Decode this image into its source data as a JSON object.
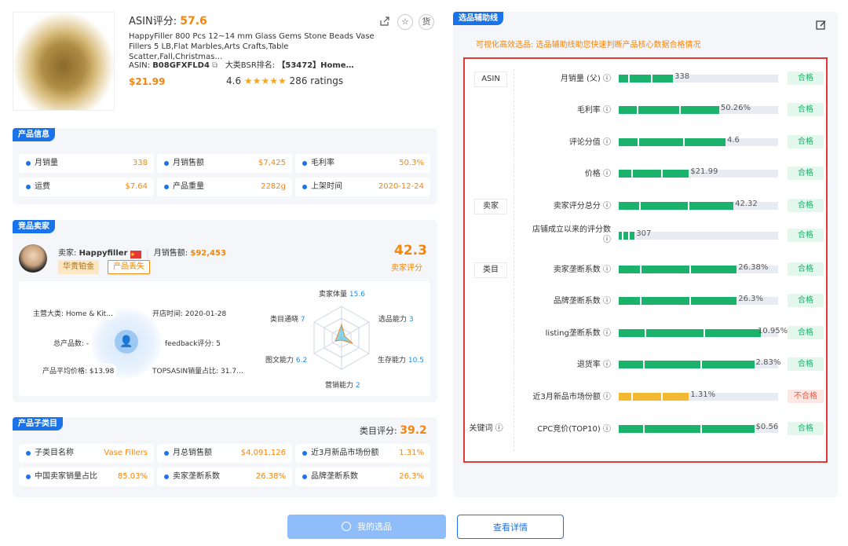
{
  "product": {
    "score_label": "ASIN评分:",
    "score": "57.6",
    "title": "HappyFiller 800 Pcs 12~14 mm Glass Gems Stone Beads Vase Fillers 5 LB,Flat Marbles,Arts Crafts,Table Scatter,Fall,Christmas…",
    "asin_label": "ASIN:",
    "asin": "B08GFXFLD4",
    "bsr_label": "大类BSR排名:",
    "bsr": "【53472】Home…",
    "price": "$21.99",
    "rating": "4.6",
    "ratings_count": "286 ratings",
    "stars": "★★★★★",
    "actions": [
      "share-icon",
      "star-icon",
      "goods-icon"
    ],
    "goods_label": "货"
  },
  "product_info": {
    "tag": "产品信息",
    "cells": [
      {
        "label": "月销量",
        "value": "338"
      },
      {
        "label": "月销售额",
        "value": "$7,425"
      },
      {
        "label": "毛利率",
        "value": "50.3%"
      },
      {
        "label": "运费",
        "value": "$7.64"
      },
      {
        "label": "产品重量",
        "value": "2282g"
      },
      {
        "label": "上架时间",
        "value": "2020-12-24"
      }
    ]
  },
  "seller": {
    "tag": "竞品卖家",
    "name_label": "卖家:",
    "name": "Happyfiller",
    "sales_label": "月销售额:",
    "sales": "$92,453",
    "badges": [
      "华贵铂金",
      "产品丢失"
    ],
    "score": "42.3",
    "score_label": "卖家评分",
    "left_info": [
      {
        "text": "主营大类: Home & Kit…"
      },
      {
        "text": "开店时间: 2020-01-28"
      },
      {
        "text": "总产品数: -"
      },
      {
        "text": "feedback评分: 5"
      },
      {
        "text": "产品平均价格: $13.98"
      },
      {
        "text": "TOPSASIN销量占比: 31.7…"
      }
    ],
    "radar": [
      {
        "label": "卖家体量",
        "value": "15.6"
      },
      {
        "label": "选品能力",
        "value": "3"
      },
      {
        "label": "生存能力",
        "value": "10.5"
      },
      {
        "label": "营销能力",
        "value": "2"
      },
      {
        "label": "图文能力",
        "value": "6.2"
      },
      {
        "label": "类目通晓",
        "value": "7"
      }
    ]
  },
  "subcategory": {
    "tag": "产品子类目",
    "score_label": "类目评分:",
    "score": "39.2",
    "cells": [
      {
        "label": "子类目名称",
        "value": "Vase Fillers"
      },
      {
        "label": "月总销售额",
        "value": "$4,091,126"
      },
      {
        "label": "近3月新品市场份额",
        "value": "1.31%"
      },
      {
        "label": "中国卖家销量占比",
        "value": "85.03%"
      },
      {
        "label": "卖家垄断系数",
        "value": "26.38%"
      },
      {
        "label": "品牌垄断系数",
        "value": "26.3%"
      }
    ]
  },
  "aid": {
    "tag": "选品辅助线",
    "subtitle": "可视化高效选品: 选品辅助线助您快速判断产品核心数据合格情况",
    "sections": [
      "ASIN",
      "卖家",
      "类目",
      "关键词 ⓘ"
    ],
    "metrics": [
      {
        "label": "月销量 (父) ⓘ",
        "value": "338",
        "fill": 0.34,
        "color": "#1bb26b",
        "status": "合格"
      },
      {
        "label": "毛利率 ⓘ",
        "value": "50.26%",
        "fill": 0.63,
        "color": "#1bb26b",
        "status": "合格"
      },
      {
        "label": "评论分值 ⓘ",
        "value": "4.6",
        "fill": 0.67,
        "color": "#1bb26b",
        "status": "合格"
      },
      {
        "label": "价格 ⓘ",
        "value": "$21.99",
        "fill": 0.44,
        "color": "#1bb26b",
        "status": "合格"
      },
      {
        "label": "卖家评分总分 ⓘ",
        "value": "42.32",
        "fill": 0.72,
        "color": "#1bb26b",
        "status": "合格"
      },
      {
        "label": "店铺成立以来的评分数 ⓘ",
        "value": "307",
        "fill": 0.1,
        "color": "#1bb26b",
        "status": "合格"
      },
      {
        "label": "卖家垄断系数 ⓘ",
        "value": "26.38%",
        "fill": 0.74,
        "color": "#1bb26b",
        "status": "合格"
      },
      {
        "label": "品牌垄断系数 ⓘ",
        "value": "26.3%",
        "fill": 0.74,
        "color": "#1bb26b",
        "status": "合格"
      },
      {
        "label": "listing垄断系数 ⓘ",
        "value": "10.95%",
        "fill": 0.89,
        "color": "#1bb26b",
        "status": "合格"
      },
      {
        "label": "退货率 ⓘ",
        "value": "2.83%",
        "fill": 0.85,
        "color": "#1bb26b",
        "status": "合格"
      },
      {
        "label": "近3月新品市场份额 ⓘ",
        "value": "1.31%",
        "fill": 0.44,
        "color": "#f3b933",
        "status": "不合格"
      },
      {
        "label": "CPC竞价(TOP10) ⓘ",
        "value": "$0.56",
        "fill": 0.85,
        "color": "#1bb26b",
        "status": "合格"
      }
    ]
  },
  "footer": {
    "primary": "我的选品",
    "secondary": "查看详情"
  }
}
